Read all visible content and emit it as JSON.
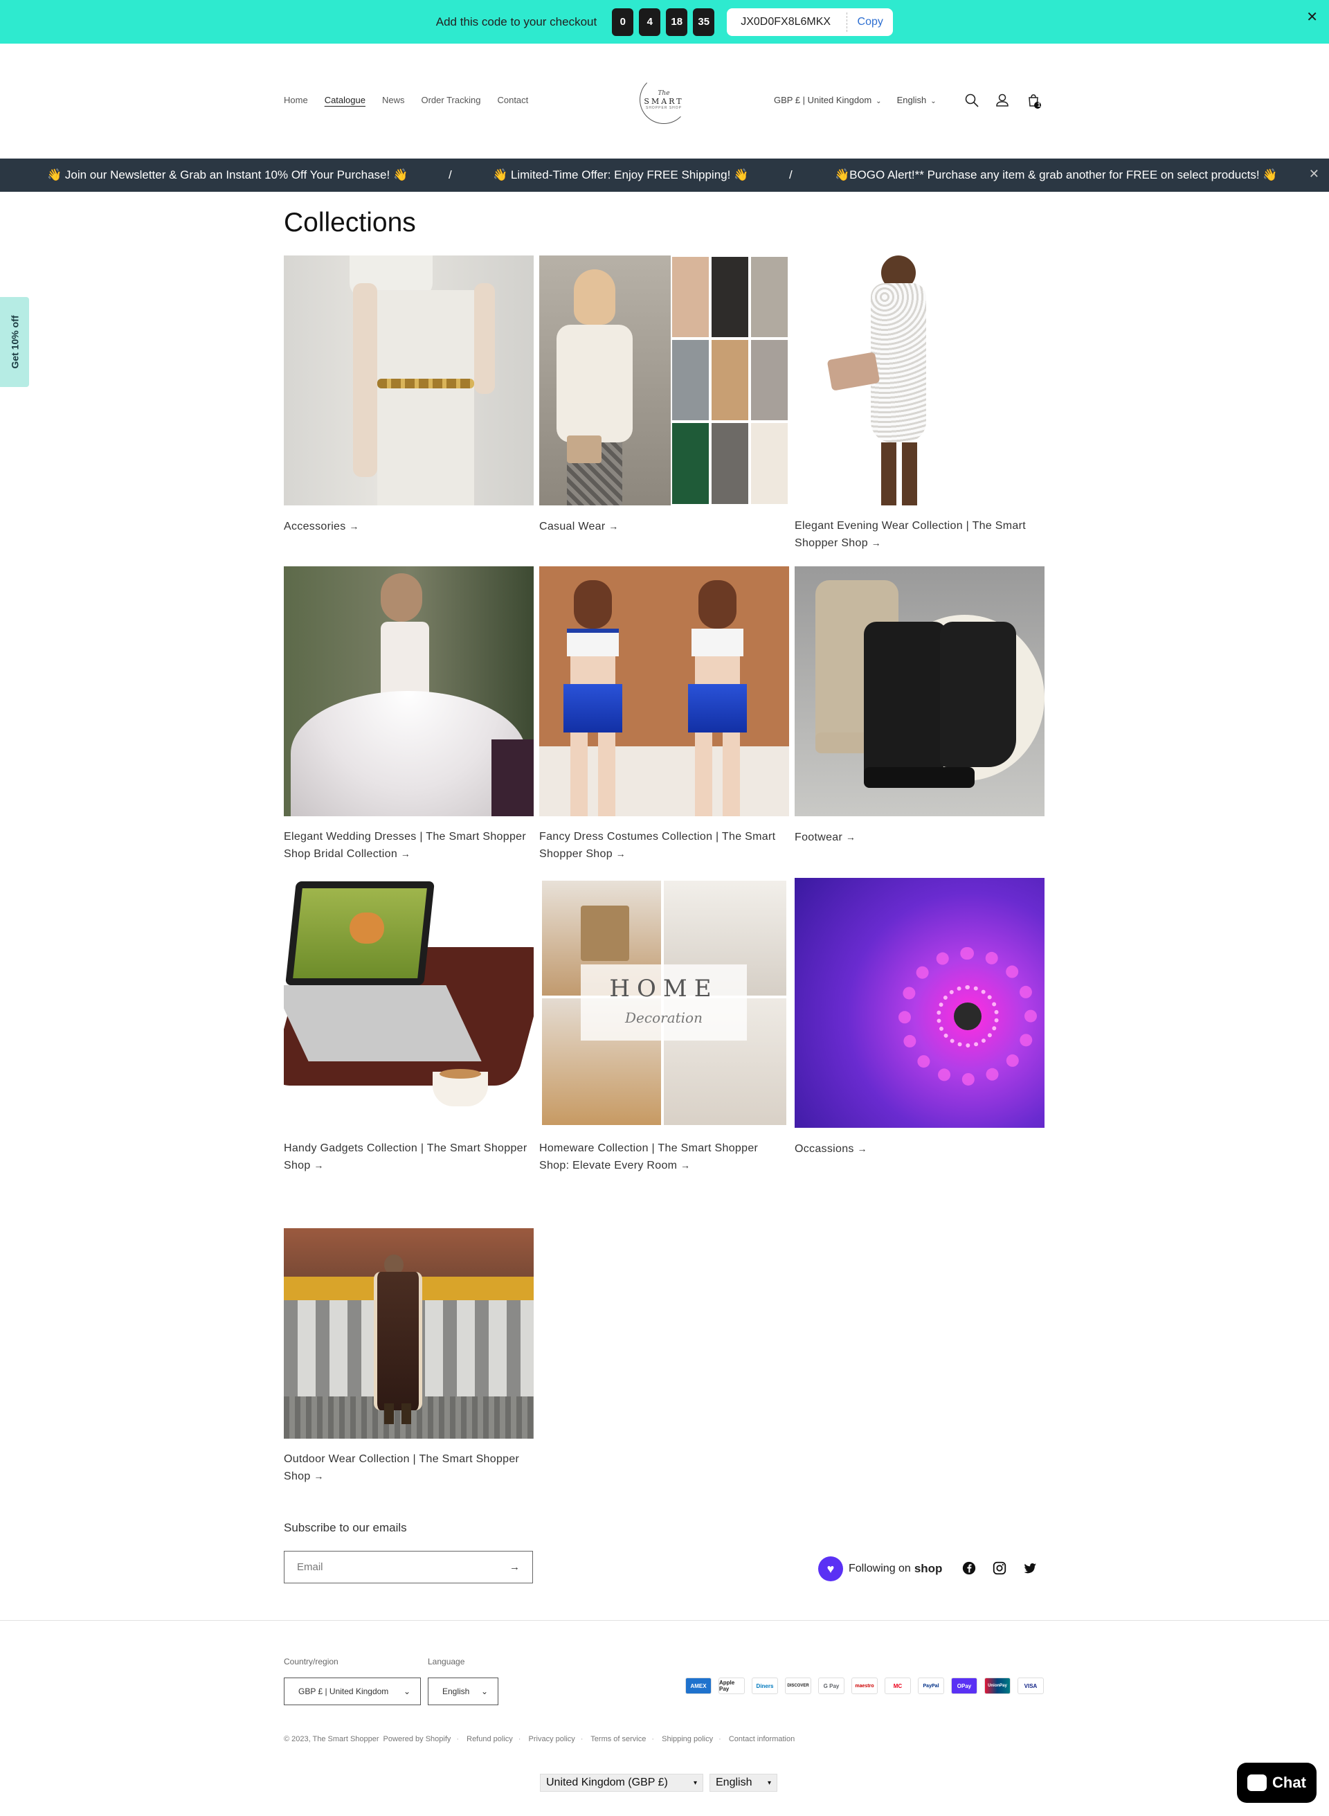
{
  "promo": {
    "text": "Add this code to your checkout",
    "countdown": [
      "0",
      "4",
      "18",
      "35"
    ],
    "code": "JX0D0FX8L6MKX",
    "copy_label": "Copy",
    "close": "✕"
  },
  "header": {
    "nav": [
      {
        "label": "Home"
      },
      {
        "label": "Catalogue"
      },
      {
        "label": "News"
      },
      {
        "label": "Order Tracking"
      },
      {
        "label": "Contact"
      }
    ],
    "logo": {
      "line1": "The",
      "line2": "SMART",
      "line3": "SHOPPER SHOP"
    },
    "currency": "GBP £ | United Kingdom",
    "language": "English",
    "cart_count": "1"
  },
  "announcement": {
    "messages": [
      "👋 Join our Newsletter & Grab an Instant 10% Off Your Purchase! 👋",
      "👋 Limited-Time Offer: Enjoy FREE Shipping! 👋",
      "👋BOGO Alert!** Purchase any item & grab another for FREE on select products! 👋"
    ],
    "separator": "/",
    "close": "✕"
  },
  "side_tab": "Get 10% off",
  "page_title": "Collections",
  "collections": [
    {
      "title": "Accessories"
    },
    {
      "title": "Casual Wear"
    },
    {
      "title": "Elegant Evening Wear Collection | The Smart Shopper Shop"
    },
    {
      "title": "Elegant Wedding Dresses | The Smart Shopper Shop Bridal Collection"
    },
    {
      "title": "Fancy Dress Costumes Collection | The Smart Shopper Shop"
    },
    {
      "title": "Footwear"
    },
    {
      "title": "Handy Gadgets Collection | The Smart Shopper Shop"
    },
    {
      "title": "Homeware Collection | The Smart Shopper Shop: Elevate Every Room"
    },
    {
      "title": "Occassions"
    },
    {
      "title": "Outdoor Wear Collection | The Smart Shopper Shop"
    }
  ],
  "homeware_overlay": {
    "word": "HOME",
    "script": "Decoration"
  },
  "arrow": "→",
  "subscribe": {
    "title": "Subscribe to our emails",
    "placeholder": "Email"
  },
  "follow": {
    "prefix": "Following on",
    "brand": "shop"
  },
  "footer": {
    "country_label": "Country/region",
    "country_value": "GBP £ | United Kingdom",
    "language_label": "Language",
    "language_value": "English",
    "payments": [
      "AMEX",
      "Apple Pay",
      "Diners",
      "DISCOVER",
      "G Pay",
      "maestro",
      "MC",
      "PayPal",
      "OPay",
      "UnionPay",
      "VISA"
    ],
    "copyright": [
      "© 2023, The Smart Shopper",
      "Powered by Shopify"
    ],
    "links": [
      "Refund policy",
      "Privacy policy",
      "Terms of service",
      "Shipping policy",
      "Contact information"
    ]
  },
  "bottom_selectors": {
    "country": "United Kingdom (GBP £)",
    "language": "English"
  },
  "chat": {
    "label": "Chat"
  },
  "colors": {
    "promo": "#2eeacf",
    "announcement": "#2b3743",
    "shop_purple": "#5a31f4"
  }
}
